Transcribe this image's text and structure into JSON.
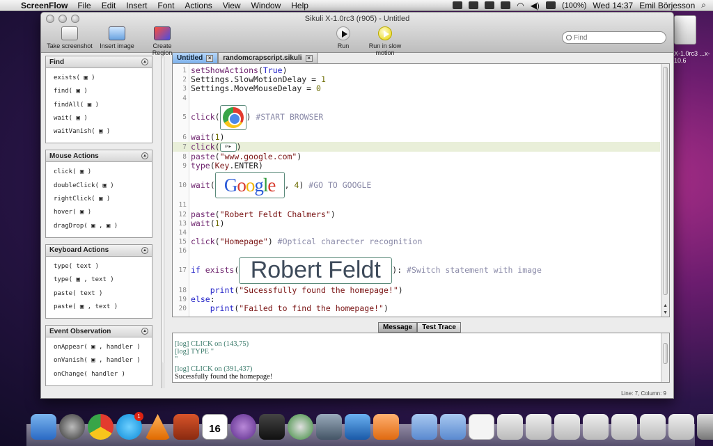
{
  "menubar": {
    "app_name": "ScreenFlow",
    "items": [
      "File",
      "Edit",
      "Insert",
      "Font",
      "Actions",
      "View",
      "Window",
      "Help"
    ],
    "battery": "(100%)",
    "clock": "Wed 14:37",
    "user": "Emil Börjesson"
  },
  "desktop": {
    "disk_label": "X-1.0rc3 ...x-10.6"
  },
  "window": {
    "title": "Sikuli X-1.0rc3 (r905) - Untitled"
  },
  "toolbar": {
    "take_screenshot": "Take screenshot",
    "insert_image": "Insert image",
    "create_region": "Create Region",
    "run": "Run",
    "run_slow": "Run in slow motion",
    "search_placeholder": "Find"
  },
  "sidebar": {
    "panels": [
      {
        "title": "Find",
        "items": [
          "exists( ▣ )",
          "find( ▣ )",
          "findAll( ▣ )",
          "wait( ▣ )",
          "waitVanish( ▣ )"
        ]
      },
      {
        "title": "Mouse Actions",
        "items": [
          "click( ▣ )",
          "doubleClick( ▣ )",
          "rightClick( ▣ )",
          "hover( ▣ )",
          "dragDrop( ▣ , ▣ )"
        ]
      },
      {
        "title": "Keyboard Actions",
        "items": [
          "type( text )",
          "type( ▣ , text )",
          "paste( text )",
          "paste( ▣ , text )"
        ]
      },
      {
        "title": "Event Observation",
        "items": [
          "onAppear( ▣ , handler )",
          "onVanish( ▣ , handler )",
          "onChange( handler )"
        ]
      }
    ]
  },
  "tabs": [
    {
      "label": "Untitled",
      "active": true
    },
    {
      "label": "randomcrapscript.sikuli",
      "active": false
    }
  ],
  "editor": {
    "lines": [
      {
        "n": "1",
        "parts": [
          [
            "fn",
            "setShowActions"
          ],
          [
            "pl",
            "("
          ],
          [
            "kw",
            "True"
          ],
          [
            "pl",
            ")"
          ]
        ]
      },
      {
        "n": "2",
        "parts": [
          [
            "pl",
            "Settings.SlowMotionDelay = "
          ],
          [
            "num",
            "1"
          ]
        ]
      },
      {
        "n": "3",
        "parts": [
          [
            "pl",
            "Settings.MoveMouseDelay = "
          ],
          [
            "num",
            "0"
          ]
        ]
      },
      {
        "n": "4",
        "parts": []
      },
      {
        "n": "5",
        "parts": [
          [
            "fn",
            "click"
          ],
          [
            "pl",
            "("
          ],
          [
            "img",
            "chrome"
          ],
          [
            "pl",
            ") "
          ],
          [
            "cm",
            "#START BROWSER"
          ]
        ]
      },
      {
        "n": "6",
        "parts": [
          [
            "fn",
            "wait"
          ],
          [
            "pl",
            "("
          ],
          [
            "num",
            "1"
          ],
          [
            "pl",
            ")"
          ]
        ]
      },
      {
        "n": "7",
        "parts": [
          [
            "fn",
            "click"
          ],
          [
            "pl",
            "("
          ],
          [
            "img",
            "search"
          ],
          [
            "pl",
            ")"
          ]
        ]
      },
      {
        "n": "8",
        "parts": [
          [
            "fn",
            "paste"
          ],
          [
            "pl",
            "("
          ],
          [
            "str",
            "\"www.google.com\""
          ],
          [
            "pl",
            ")"
          ]
        ]
      },
      {
        "n": "9",
        "parts": [
          [
            "fn",
            "type"
          ],
          [
            "pl",
            "("
          ],
          [
            "str",
            "Key"
          ],
          [
            "pl",
            ".ENTER)"
          ]
        ]
      },
      {
        "n": "10",
        "parts": [
          [
            "fn",
            "wait"
          ],
          [
            "pl",
            "("
          ],
          [
            "img",
            "google"
          ],
          [
            "pl",
            ", "
          ],
          [
            "num",
            "4"
          ],
          [
            "pl",
            ") "
          ],
          [
            "cm",
            "#GO TO GOOGLE"
          ]
        ]
      },
      {
        "n": "11",
        "parts": []
      },
      {
        "n": "12",
        "parts": [
          [
            "fn",
            "paste"
          ],
          [
            "pl",
            "("
          ],
          [
            "str",
            "\"Robert Feldt Chalmers\""
          ],
          [
            "pl",
            ")"
          ]
        ]
      },
      {
        "n": "13",
        "parts": [
          [
            "fn",
            "wait"
          ],
          [
            "pl",
            "("
          ],
          [
            "num",
            "1"
          ],
          [
            "pl",
            ")"
          ]
        ]
      },
      {
        "n": "14",
        "parts": []
      },
      {
        "n": "15",
        "parts": [
          [
            "fn",
            "click"
          ],
          [
            "pl",
            "("
          ],
          [
            "str",
            "\"Homepage\""
          ],
          [
            "pl",
            ") "
          ],
          [
            "cm",
            "#Optical charecter recognition"
          ]
        ]
      },
      {
        "n": "16",
        "parts": []
      },
      {
        "n": "17",
        "parts": [
          [
            "kw",
            "if "
          ],
          [
            "fn",
            "exists"
          ],
          [
            "pl",
            "("
          ],
          [
            "img",
            "rf"
          ],
          [
            "pl",
            "): "
          ],
          [
            "cm",
            "#Switch statement with image"
          ]
        ]
      },
      {
        "n": "18",
        "parts": [
          [
            "pl",
            "    "
          ],
          [
            "kw",
            "print"
          ],
          [
            "pl",
            "("
          ],
          [
            "str",
            "\"Sucessfully found the homepage!\""
          ],
          [
            "pl",
            ")"
          ]
        ]
      },
      {
        "n": "19",
        "parts": [
          [
            "kw",
            "else"
          ],
          [
            "pl",
            ":"
          ]
        ]
      },
      {
        "n": "20",
        "parts": [
          [
            "pl",
            "    "
          ],
          [
            "kw",
            "print"
          ],
          [
            "pl",
            "("
          ],
          [
            "str",
            "\"Failed to find the homepage!\""
          ],
          [
            "pl",
            ")"
          ]
        ]
      }
    ],
    "image_text": {
      "google": "Google",
      "rf": "Robert Feldt"
    }
  },
  "message_panel": {
    "tabs": [
      "Message",
      "Test Trace"
    ],
    "lines": [
      {
        "kind": "log",
        "text": "[log] CLICK on (143,75)"
      },
      {
        "kind": "log",
        "text": "[log] TYPE \""
      },
      {
        "kind": "log",
        "text": "\""
      },
      {
        "kind": "log",
        "text": "[log] CLICK on (391,437)"
      },
      {
        "kind": "out",
        "text": "Sucessfully found the homepage!"
      }
    ]
  },
  "status": {
    "position": "Line: 7, Column: 9"
  },
  "dock": {
    "skype_badge": "1",
    "calendar_day": "16"
  }
}
